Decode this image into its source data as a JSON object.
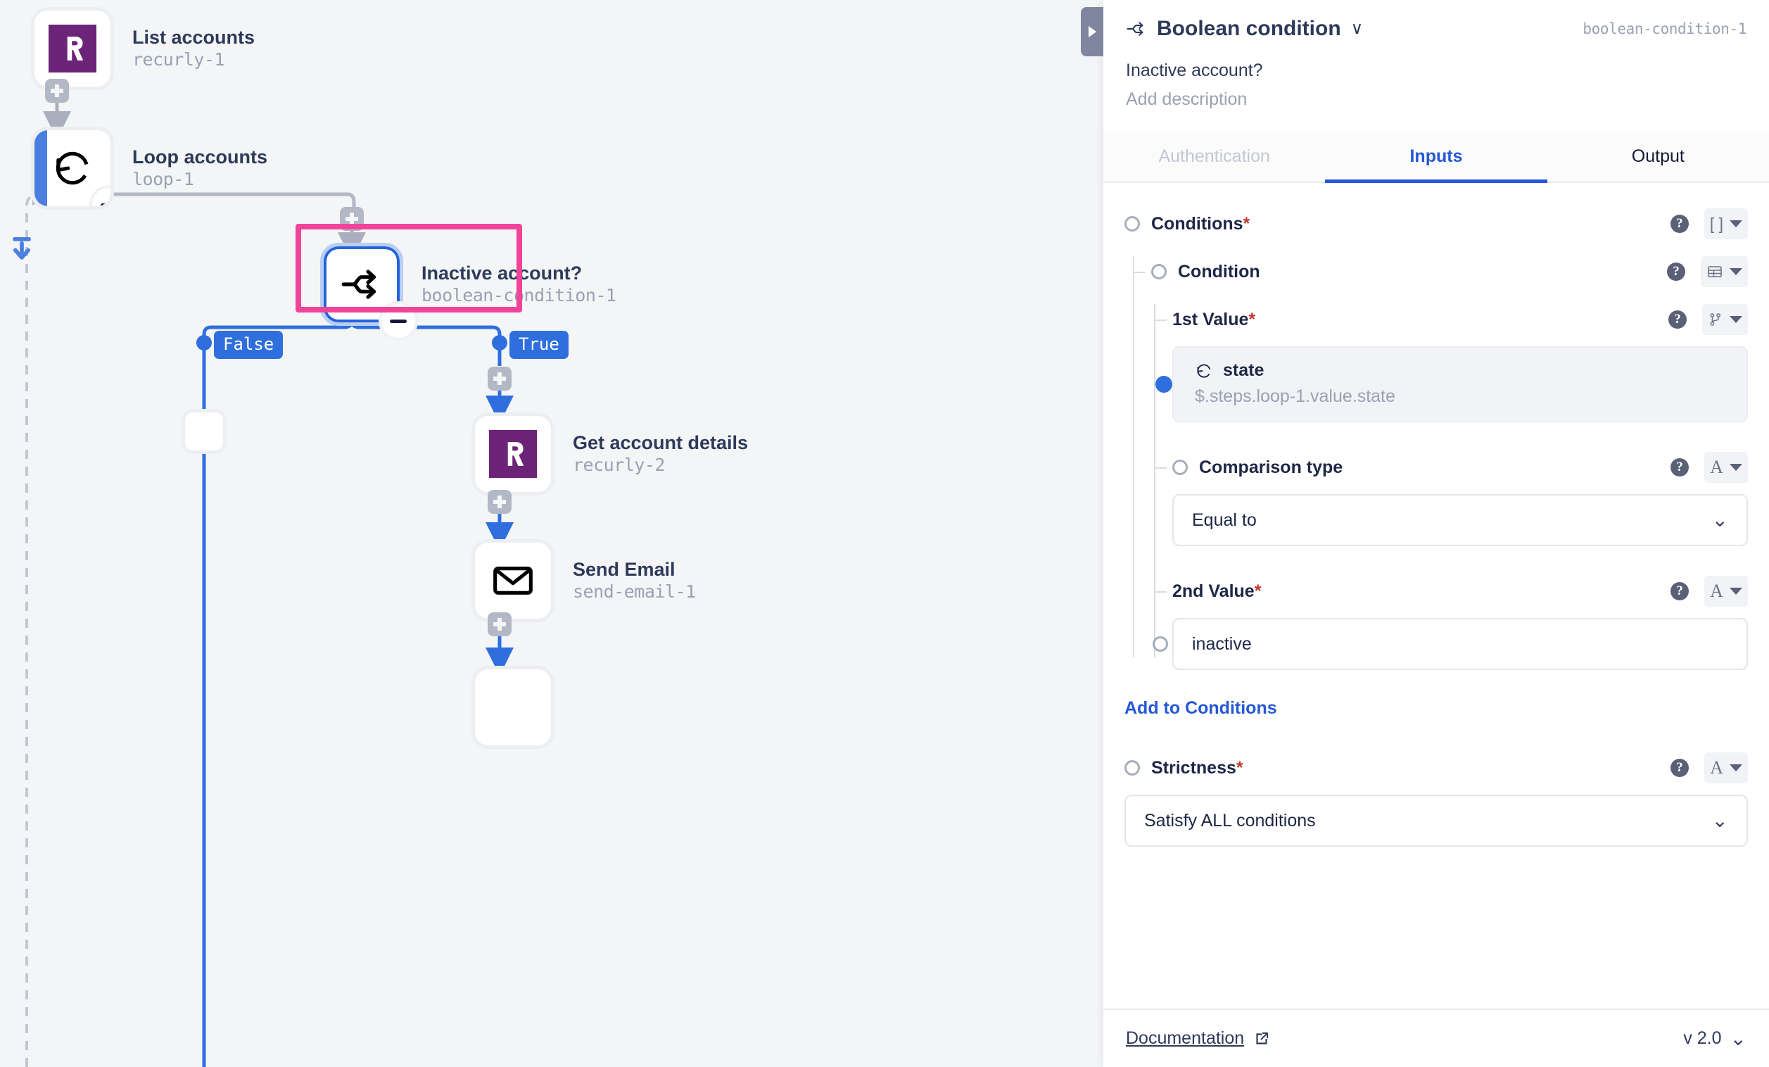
{
  "canvas": {
    "nodes": [
      {
        "id": "n1",
        "title": "List accounts",
        "subtitle": "recurly-1",
        "icon": "recurly-icon"
      },
      {
        "id": "n2",
        "title": "Loop accounts",
        "subtitle": "loop-1",
        "icon": "loop-icon"
      },
      {
        "id": "n3",
        "title": "Inactive account?",
        "subtitle": "boolean-condition-1",
        "icon": "branch-icon"
      },
      {
        "id": "n4",
        "title": "Get account details",
        "subtitle": "recurly-2",
        "icon": "recurly-icon"
      },
      {
        "id": "n5",
        "title": "Send Email",
        "subtitle": "send-email-1",
        "icon": "envelope-icon"
      }
    ],
    "branch_labels": {
      "false": "False",
      "true": "True"
    },
    "colors": {
      "branch_blue": "#2f6fdd",
      "highlight_pink": "#f0449b",
      "recurly_purple": "#6b2477"
    }
  },
  "panel": {
    "header": {
      "icon": "branch-icon",
      "title": "Boolean condition",
      "chevron": "∨",
      "step_id": "boolean-condition-1",
      "step_name": "Inactive account?",
      "description_placeholder": "Add description"
    },
    "tabs": [
      {
        "label": "Authentication",
        "state": "disabled"
      },
      {
        "label": "Inputs",
        "state": "active"
      },
      {
        "label": "Output",
        "state": "default"
      }
    ],
    "fields": {
      "conditions": {
        "label": "Conditions",
        "required": "*",
        "type_glyph": "[ ]",
        "help": "?"
      },
      "condition": {
        "label": "Condition",
        "type_glyph": "table-icon",
        "help": "?"
      },
      "first_value": {
        "label": "1st Value",
        "required": "*",
        "type_glyph": "branch-icon",
        "help": "?",
        "chip_icon": "loop-icon",
        "chip_name": "state",
        "chip_path": "$.steps.loop-1.value.state"
      },
      "comparison_type": {
        "label": "Comparison type",
        "type_glyph": "A",
        "help": "?",
        "value": "Equal to"
      },
      "second_value": {
        "label": "2nd Value",
        "required": "*",
        "type_glyph": "A",
        "help": "?",
        "value": "inactive"
      },
      "add_to_conditions": {
        "label": "Add to Conditions"
      },
      "strictness": {
        "label": "Strictness",
        "required": "*",
        "type_glyph": "A",
        "help": "?",
        "value": "Satisfy ALL conditions"
      }
    },
    "footer": {
      "documentation_label": "Documentation",
      "external_icon": "external-link-icon",
      "version": "v 2.0",
      "version_chevron": "∨"
    }
  }
}
